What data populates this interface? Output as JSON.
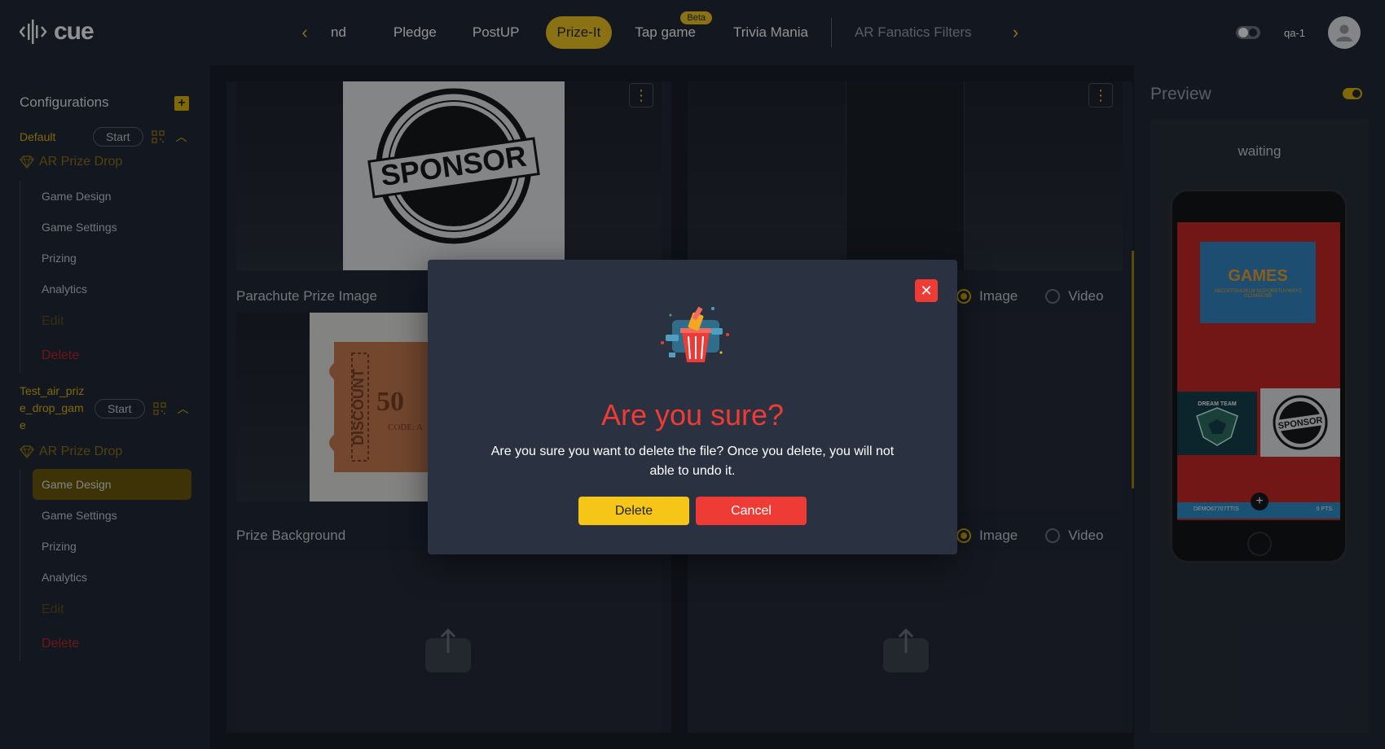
{
  "app": {
    "logo": "cue"
  },
  "nav": {
    "items": [
      {
        "label": "nd"
      },
      {
        "label": "Pledge"
      },
      {
        "label": "PostUP"
      },
      {
        "label": "Prize-It",
        "active": true
      },
      {
        "label": "Tap game",
        "badge": "Beta"
      },
      {
        "label": "Trivia Mania"
      },
      {
        "label": "AR Fanatics Filters"
      }
    ],
    "user": "qa-1"
  },
  "sidebar": {
    "title": "Configurations",
    "configs": [
      {
        "name": "Default",
        "start_label": "Start",
        "game": "AR Prize Drop",
        "items": [
          "Game Design",
          "Game Settings",
          "Prizing",
          "Analytics"
        ],
        "edit_label": "Edit",
        "delete_label": "Delete"
      },
      {
        "name": "Test_air_prize_drop_game",
        "start_label": "Start",
        "game": "AR Prize Drop",
        "items": [
          "Game Design",
          "Game Settings",
          "Prizing",
          "Analytics"
        ],
        "active_item": "Game Design",
        "edit_label": "Edit",
        "delete_label": "Delete"
      }
    ]
  },
  "main": {
    "sections": [
      {
        "label": "Parachute Prize Image",
        "radio_image": "Image",
        "radio_video": "Video"
      },
      {
        "label": "Prize Background",
        "radio_image": "Image",
        "radio_video": "Video"
      }
    ],
    "sponsor_text": "SPONSOR",
    "discount_text": "DISCOUNT",
    "discount_value": "50",
    "discount_code": "CODE: A"
  },
  "preview": {
    "title": "Preview",
    "status": "waiting",
    "games_banner": "GAMES",
    "games_sub": "ABCDEFGHIJKLM NOPQRSTUVWXYZ 0123456789",
    "team_label": "DREAM TEAM",
    "sponsor_label": "SPONSOR",
    "strip_text": "DEMO67707TTIS",
    "strip_pts": "0 PTS."
  },
  "modal": {
    "title": "Are you sure?",
    "message": "Are you sure you want to delete the file? Once you delete, you will not able to undo it.",
    "delete_label": "Delete",
    "cancel_label": "Cancel"
  },
  "colors": {
    "accent": "#f5c518",
    "danger": "#ef3b35",
    "bg": "#131720",
    "panel": "#1c222e"
  }
}
